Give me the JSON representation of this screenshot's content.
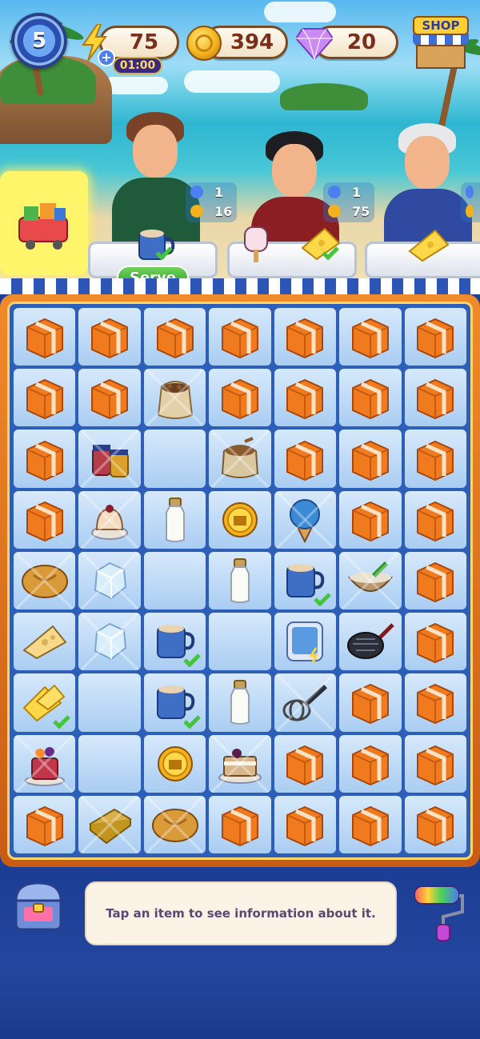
{
  "hud": {
    "level": "5",
    "energy": "75",
    "energy_timer": "01:00",
    "energy_plus": "+",
    "coins": "394",
    "gems": "20",
    "shop_label": "SHOP"
  },
  "orders": [
    {
      "customer": "woman-glasses",
      "item": "coffee-mug",
      "ready": true,
      "serve_label": "Serve",
      "badge": {
        "stars": "1",
        "coins": "16"
      }
    },
    {
      "customer": "man-red-vest",
      "items": [
        "ice-cream-bar",
        "cheese"
      ],
      "badge": {
        "stars": "1",
        "coins": "75"
      }
    },
    {
      "customer": "old-man",
      "item": "cheese",
      "badge": {
        "stars": "",
        "coins": ""
      }
    }
  ],
  "board": {
    "columns": 7,
    "rows": [
      [
        "box",
        "box",
        "box",
        "box",
        "box",
        "box",
        "box"
      ],
      [
        "box",
        "box",
        "coffee-sack",
        "box",
        "box",
        "box",
        "box"
      ],
      [
        "box",
        "jam-jars",
        "empty",
        "nut-bag",
        "box",
        "box",
        "box"
      ],
      [
        "box",
        "dessert",
        "milk-bottle",
        "coin",
        "ice-cream-cone",
        "box",
        "box"
      ],
      [
        "bread",
        "ice-cube",
        "empty",
        "milk-bottle",
        "coffee-mug-check",
        "whisk-bowl",
        "box"
      ],
      [
        "cheese-slice",
        "ice-cube",
        "coffee-mug-check",
        "empty",
        "freezer",
        "sieve",
        "box"
      ],
      [
        "cheese-check",
        "empty",
        "coffee-mug-check",
        "milk-bottle",
        "whisk",
        "box",
        "box"
      ],
      [
        "cake",
        "empty",
        "coin",
        "tiramisu",
        "box",
        "box",
        "box"
      ],
      [
        "box",
        "butter",
        "bread",
        "box",
        "box",
        "box",
        "box"
      ]
    ],
    "webbed": [
      [
        1,
        2
      ],
      [
        2,
        1
      ],
      [
        2,
        3
      ],
      [
        3,
        1
      ],
      [
        3,
        4
      ],
      [
        4,
        0
      ],
      [
        4,
        1
      ],
      [
        4,
        5
      ],
      [
        5,
        1
      ],
      [
        6,
        4
      ],
      [
        7,
        0
      ],
      [
        7,
        3
      ],
      [
        8,
        1
      ],
      [
        8,
        2
      ]
    ]
  },
  "bottom": {
    "info_text": "Tap an item to see information about it.",
    "left_tool": "storage-chest-icon",
    "right_tool": "paint-roller-icon"
  },
  "colors": {
    "board_bg": "#2e5fb8",
    "board_frame": "#f08a2a",
    "box_orange": "#f07a1e",
    "serve_green": "#3fae36",
    "info_bg": "#fbf3e6"
  }
}
